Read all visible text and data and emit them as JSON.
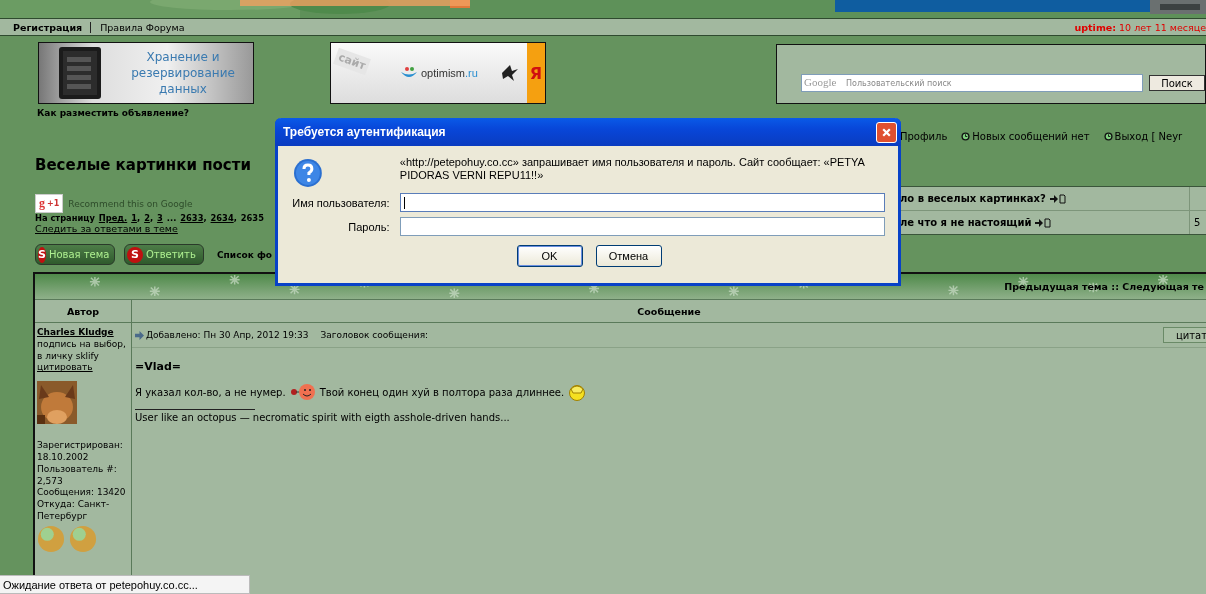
{
  "nav": {
    "items": [
      "Регистрация",
      "Правила Форума"
    ],
    "uptime_label": "uptime:",
    "uptime_value": "10 лет 11 месяце"
  },
  "ads": [
    {
      "kind": "storage",
      "text": "Хранение и резервирование данных"
    },
    {
      "kind": "optimism",
      "panel": "сайт",
      "brand": "optimism",
      "domain": ".ru",
      "tab": "Я"
    }
  ],
  "search": {
    "logo": "Google",
    "placeholder": "Пользовательский поиск",
    "button": "Поиск"
  },
  "ad_link": "Как разместить объявление?",
  "user_nav": [
    {
      "label": "Профиль",
      "icon": false
    },
    {
      "label": "Новых сообщений нет",
      "icon": true
    },
    {
      "label": "Выход [ Neyr",
      "icon": true
    }
  ],
  "topic": {
    "title": "Веселые картинки пости",
    "plus_one_icon": "g",
    "plus_one": "+1",
    "recommend": "Recommend this on Google",
    "pager": [
      {
        "text": "На страницу",
        "link": false
      },
      {
        "text": "Пред.",
        "link": true
      },
      {
        "text": "1",
        "link": true
      },
      {
        "text": ",",
        "link": false,
        "joined": true
      },
      {
        "text": "2",
        "link": true
      },
      {
        "text": ",",
        "link": false,
        "joined": true
      },
      {
        "text": "3",
        "link": true
      },
      {
        "text": "...",
        "link": false
      },
      {
        "text": "2633",
        "link": true
      },
      {
        "text": ",",
        "link": false,
        "joined": true
      },
      {
        "text": "2634",
        "link": true
      },
      {
        "text": ",",
        "link": false,
        "joined": true
      },
      {
        "text": "2635",
        "link": false
      }
    ],
    "watch_link": "Следить за ответами в теме"
  },
  "related": [
    {
      "title": "ло в веселых картинках?"
    },
    {
      "title": "ле что я не настоящий",
      "column_2": "5"
    }
  ],
  "actions": [
    {
      "icon": "S",
      "label": "Новая тема"
    },
    {
      "icon": "S",
      "label": "Ответить"
    }
  ],
  "forum_list": "Список фо",
  "topic_nav": "Предыдущая тема :: Следующая те",
  "table": {
    "columns": [
      "Автор",
      "Сообщение"
    ]
  },
  "post": {
    "author": "Charles Kludge",
    "signature": "подпись на выбор, в личку sklify",
    "quote_link": "цитировать",
    "profile": [
      "Зарегистрирован: 18.10.2002",
      "Пользователь #: 2,573",
      "Сообщения: 13420",
      "Откуда: Санкт-Петербург"
    ],
    "posted": "Добавлено: Пн 30 Апр, 2012 19:33",
    "subject_label": "Заголовок сообщения:",
    "quote_button": "цитат",
    "greeting": "=Vlad=",
    "line_1": "Я указал кол-во, а не нумер.",
    "line_2": "Твой конец один хуй в полтора раза длиннее.",
    "signature_text": "User like an octopus — necromatic spirit with eigth asshole-driven hands..."
  },
  "dialog": {
    "title": "Требуется аутентификация",
    "message": "«http://petepohuy.co.cc» запрашивает имя пользователя и пароль. Сайт сообщает: «PETYA PIDORAS VERNI REPU11!!»",
    "fields": [
      {
        "label": "Имя пользователя:",
        "focused": true
      },
      {
        "label": "Пароль:",
        "focused": false
      }
    ],
    "buttons": [
      {
        "label": "OK",
        "default": true
      },
      {
        "label": "Отмена",
        "default": false
      }
    ]
  },
  "status": "Ожидание ответа от petepohuy.co.cc..."
}
